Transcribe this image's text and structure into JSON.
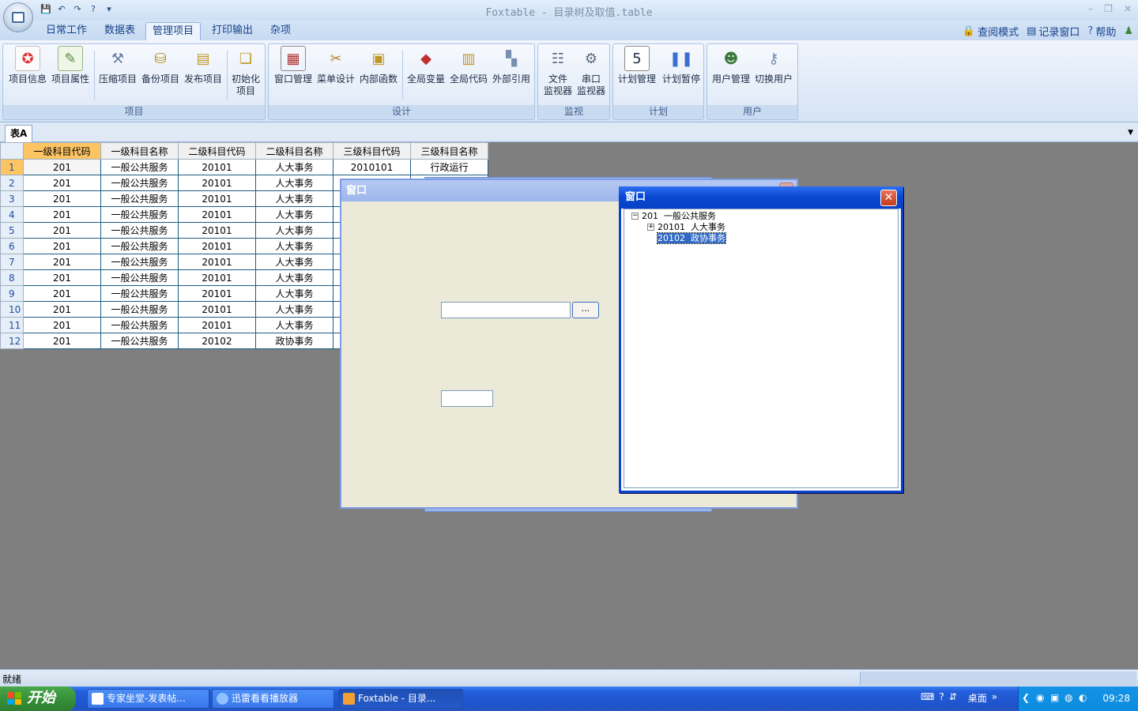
{
  "window": {
    "title": "Foxtable - 目录树及取值.table",
    "minimize": "–",
    "restore": "❐",
    "close": "✕"
  },
  "quick_access": [
    "💾",
    "↶",
    "↷",
    "?",
    "▾"
  ],
  "menu_tabs": [
    "日常工作",
    "数据表",
    "管理项目",
    "打印输出",
    "杂项"
  ],
  "right_links": [
    "查阅模式",
    "记录窗口",
    "帮助"
  ],
  "ribbon": {
    "groups": [
      {
        "label": "项目",
        "buttons": [
          "项目信息",
          "项目属性",
          "压缩项目",
          "备份项目",
          "发布项目",
          "初始化\n项目"
        ]
      },
      {
        "label": "设计",
        "buttons": [
          "窗口管理",
          "菜单设计",
          "内部函数",
          "全局变量",
          "全局代码",
          "外部引用"
        ]
      },
      {
        "label": "监视",
        "buttons": [
          "文件\n监视器",
          "串口\n监视器"
        ]
      },
      {
        "label": "计划",
        "buttons": [
          "计划管理",
          "计划暂停"
        ]
      },
      {
        "label": "用户",
        "buttons": [
          "用户管理",
          "切换用户"
        ]
      }
    ]
  },
  "sheet_tab": "表A",
  "table": {
    "headers": [
      "一级科目代码",
      "一级科目名称",
      "二级科目代码",
      "二级科目名称",
      "三级科目代码",
      "三级科目名称"
    ],
    "rows": [
      [
        "201",
        "一般公共服务",
        "20101",
        "人大事务",
        "2010101",
        "行政运行"
      ],
      [
        "201",
        "一般公共服务",
        "20101",
        "人大事务",
        "",
        ""
      ],
      [
        "201",
        "一般公共服务",
        "20101",
        "人大事务",
        "",
        ""
      ],
      [
        "201",
        "一般公共服务",
        "20101",
        "人大事务",
        "",
        ""
      ],
      [
        "201",
        "一般公共服务",
        "20101",
        "人大事务",
        "",
        ""
      ],
      [
        "201",
        "一般公共服务",
        "20101",
        "人大事务",
        "",
        ""
      ],
      [
        "201",
        "一般公共服务",
        "20101",
        "人大事务",
        "",
        ""
      ],
      [
        "201",
        "一般公共服务",
        "20101",
        "人大事务",
        "",
        ""
      ],
      [
        "201",
        "一般公共服务",
        "20101",
        "人大事务",
        "",
        ""
      ],
      [
        "201",
        "一般公共服务",
        "20101",
        "人大事务",
        "",
        ""
      ],
      [
        "201",
        "一般公共服务",
        "20101",
        "人大事务",
        "",
        ""
      ],
      [
        "201",
        "一般公共服务",
        "20102",
        "政协事务",
        "",
        ""
      ]
    ]
  },
  "form_window": {
    "title": "窗口",
    "input_value": "",
    "button_label": "...",
    "input2_value": ""
  },
  "tree_window": {
    "title": "窗口",
    "nodes": [
      {
        "text": "201  一般公共服务",
        "expander": "−",
        "level": 0
      },
      {
        "text": "20101  人大事务",
        "expander": "+",
        "level": 1
      },
      {
        "text": "20102  政协事务",
        "expander": "",
        "level": 1,
        "selected": true
      }
    ]
  },
  "status": "就绪",
  "taskbar": {
    "start": "开始",
    "tasks": [
      "专家坐堂-发表帖...",
      "迅雷看看播放器",
      "Foxtable - 目录..."
    ],
    "quick_label": "桌面",
    "clock": "09:28"
  }
}
